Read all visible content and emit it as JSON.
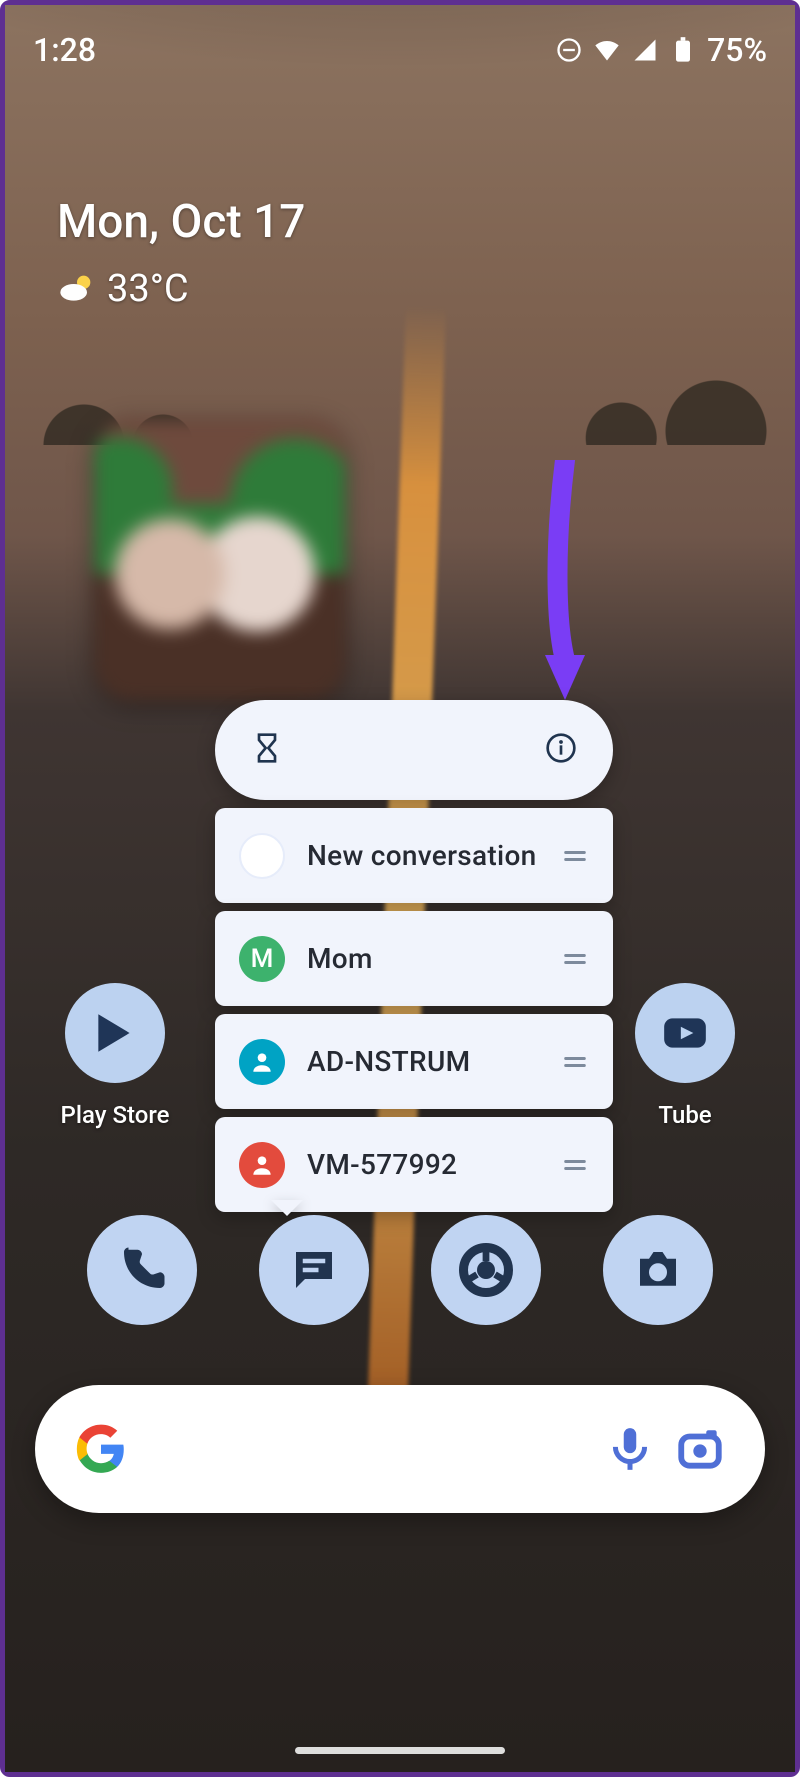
{
  "statusbar": {
    "time": "1:28",
    "battery": "75%"
  },
  "widget": {
    "date": "Mon, Oct 17",
    "temp": "33°C"
  },
  "shortcut_menu": {
    "items": [
      {
        "label": "New conversation"
      },
      {
        "label": "Mom",
        "initial": "M"
      },
      {
        "label": "AD-NSTRUM"
      },
      {
        "label": "VM-577992"
      }
    ]
  },
  "apps": {
    "playstore_label": "Play Store",
    "youtube_label": "Tube"
  },
  "colors": {
    "accent_purple": "#7a3df5",
    "bubble": "#bfd3f1",
    "bubble_icon": "#20344f",
    "popup_bg": "#f1f4fc"
  }
}
